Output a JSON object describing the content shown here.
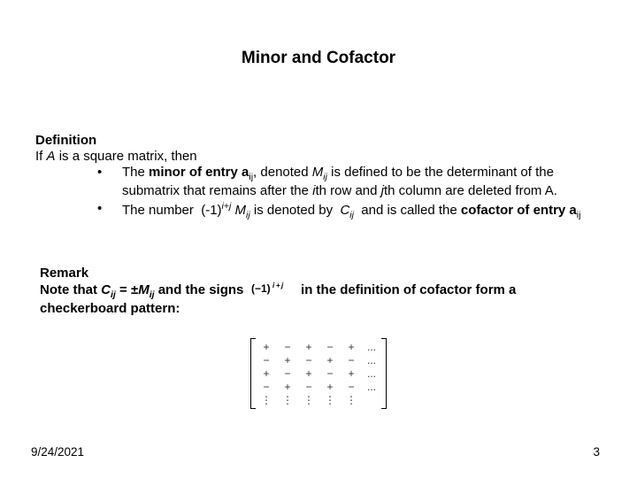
{
  "title": "Minor and Cofactor",
  "definition": {
    "heading": "Definition",
    "lead": "If A is a square matrix, then",
    "bullets": [
      "The minor of entry a_ij, denoted M_ij is defined to be the determinant of the submatrix that remains after the ith row and jth column are deleted from A.",
      "The number (-1)^{i+j} M_ij is denoted by C_ij and is called the cofactor of entry a_ij"
    ]
  },
  "remark": {
    "heading": "Remark",
    "text": "Note that C_ij = ±M_ij and the signs (-1)^{i+j} in the definition of cofactor form a checkerboard pattern:"
  },
  "matrix": [
    [
      "+",
      "−",
      "+",
      "−",
      "+",
      "..."
    ],
    [
      "−",
      "+",
      "−",
      "+",
      "−",
      "..."
    ],
    [
      "+",
      "−",
      "+",
      "−",
      "+",
      "..."
    ],
    [
      "−",
      "+",
      "−",
      "+",
      "−",
      "..."
    ],
    [
      "⋮",
      "⋮",
      "⋮",
      "⋮",
      "⋮",
      ""
    ]
  ],
  "footer": {
    "date": "9/24/2021",
    "page": "3"
  }
}
